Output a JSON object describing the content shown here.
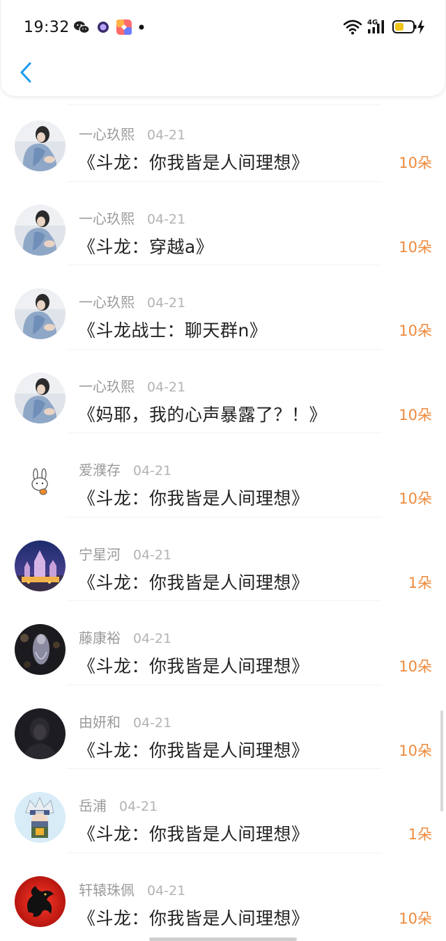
{
  "status_bar": {
    "time": "19:32",
    "icons": [
      "wechat-icon",
      "purple-circle-app-icon",
      "app-shortcut-icon",
      "notification-dot-icon",
      "wifi-icon",
      "signal-4g-icon",
      "battery-charging-icon"
    ],
    "network_label": "4G"
  },
  "header": {
    "back_icon": "chevron-left-icon",
    "accent_color": "#1a9bf0"
  },
  "list": {
    "amount_color": "#ee8a3c",
    "items": [
      {
        "name": "一心玖熙",
        "date": "04-21",
        "title": "《斗龙：你我皆是人间理想》",
        "amount": "10朵",
        "avatar": "avatar-girl-icon"
      },
      {
        "name": "一心玖熙",
        "date": "04-21",
        "title": "《斗龙：穿越a》",
        "amount": "10朵",
        "avatar": "avatar-girl-icon"
      },
      {
        "name": "一心玖熙",
        "date": "04-21",
        "title": "《斗龙战士：聊天群n》",
        "amount": "10朵",
        "avatar": "avatar-girl-icon"
      },
      {
        "name": "一心玖熙",
        "date": "04-21",
        "title": "《妈耶，我的心声暴露了？！》",
        "amount": "10朵",
        "avatar": "avatar-girl-icon"
      },
      {
        "name": "爱濮存",
        "date": "04-21",
        "title": "《斗龙：你我皆是人间理想》",
        "amount": "10朵",
        "avatar": "avatar-bunny-icon"
      },
      {
        "name": "宁星河",
        "date": "04-21",
        "title": "《斗龙：你我皆是人间理想》",
        "amount": "1朵",
        "avatar": "avatar-castle-icon"
      },
      {
        "name": "藤康裕",
        "date": "04-21",
        "title": "《斗龙：你我皆是人间理想》",
        "amount": "10朵",
        "avatar": "avatar-dark-figure-icon"
      },
      {
        "name": "由妍和",
        "date": "04-21",
        "title": "《斗龙：你我皆是人间理想》",
        "amount": "10朵",
        "avatar": "avatar-dark-portrait-icon"
      },
      {
        "name": "岳浦",
        "date": "04-21",
        "title": "《斗龙：你我皆是人间理想》",
        "amount": "1朵",
        "avatar": "avatar-ninja-icon"
      },
      {
        "name": "轩辕珠佩",
        "date": "04-21",
        "title": "《斗龙：你我皆是人间理想》",
        "amount": "10朵",
        "avatar": "avatar-dragon-icon"
      }
    ]
  }
}
